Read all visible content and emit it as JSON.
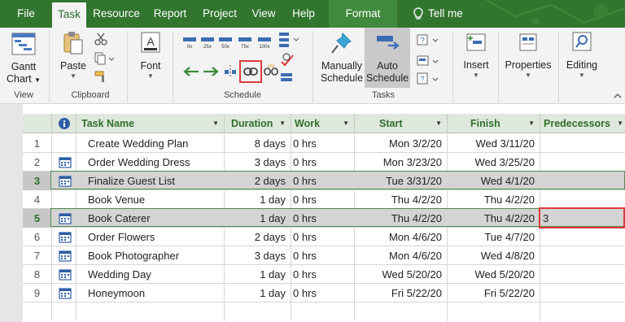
{
  "tabs": [
    {
      "label": "File"
    },
    {
      "label": "Task"
    },
    {
      "label": "Resource"
    },
    {
      "label": "Report"
    },
    {
      "label": "Project"
    },
    {
      "label": "View"
    },
    {
      "label": "Help"
    },
    {
      "label": "Format"
    }
  ],
  "tell_me": "Tell me",
  "ribbon": {
    "groups": {
      "view": "View",
      "clipboard": "Clipboard",
      "schedule": "Schedule",
      "tasks": "Tasks"
    },
    "gantt_chart": [
      "Gantt",
      "Chart"
    ],
    "paste": "Paste",
    "font": "Font",
    "manually_schedule": [
      "Manually",
      "Schedule"
    ],
    "auto_schedule": [
      "Auto",
      "Schedule"
    ],
    "insert": "Insert",
    "properties": "Properties",
    "editing": "Editing",
    "percent_buttons": [
      "0x",
      "25x",
      "50x",
      "75x",
      "100x"
    ]
  },
  "columns": {
    "task_name": "Task Name",
    "duration": "Duration",
    "work": "Work",
    "start": "Start",
    "finish": "Finish",
    "predecessors": "Predecessors"
  },
  "rows": [
    {
      "id": "1",
      "name": "Create Wedding Plan",
      "duration": "8 days",
      "work": "0 hrs",
      "start": "Mon 3/2/20",
      "finish": "Wed 3/11/20",
      "pred": "",
      "icon": false
    },
    {
      "id": "2",
      "name": "Order Wedding Dress",
      "duration": "3 days",
      "work": "0 hrs",
      "start": "Mon 3/23/20",
      "finish": "Wed 3/25/20",
      "pred": "",
      "icon": true
    },
    {
      "id": "3",
      "name": "Finalize Guest List",
      "duration": "2 days",
      "work": "0 hrs",
      "start": "Tue 3/31/20",
      "finish": "Wed 4/1/20",
      "pred": "",
      "icon": true
    },
    {
      "id": "4",
      "name": "Book Venue",
      "duration": "1 day",
      "work": "0 hrs",
      "start": "Thu 4/2/20",
      "finish": "Thu 4/2/20",
      "pred": "",
      "icon": false
    },
    {
      "id": "5",
      "name": "Book Caterer",
      "duration": "1 day",
      "work": "0 hrs",
      "start": "Thu 4/2/20",
      "finish": "Thu 4/2/20",
      "pred": "3",
      "icon": true
    },
    {
      "id": "6",
      "name": "Order Flowers",
      "duration": "2 days",
      "work": "0 hrs",
      "start": "Mon 4/6/20",
      "finish": "Tue 4/7/20",
      "pred": "",
      "icon": true
    },
    {
      "id": "7",
      "name": "Book Photographer",
      "duration": "3 days",
      "work": "0 hrs",
      "start": "Mon 4/6/20",
      "finish": "Wed 4/8/20",
      "pred": "",
      "icon": true
    },
    {
      "id": "8",
      "name": "Wedding Day",
      "duration": "1 day",
      "work": "0 hrs",
      "start": "Wed 5/20/20",
      "finish": "Wed 5/20/20",
      "pred": "",
      "icon": true
    },
    {
      "id": "9",
      "name": "Honeymoon",
      "duration": "1 day",
      "work": "0 hrs",
      "start": "Fri 5/22/20",
      "finish": "Fri 5/22/20",
      "pred": "",
      "icon": true
    }
  ],
  "colors": {
    "accent": "#31752f",
    "header_text": "#2f6e2c",
    "highlight": "#e03b3b",
    "selected_row": "#d4d4d4"
  }
}
